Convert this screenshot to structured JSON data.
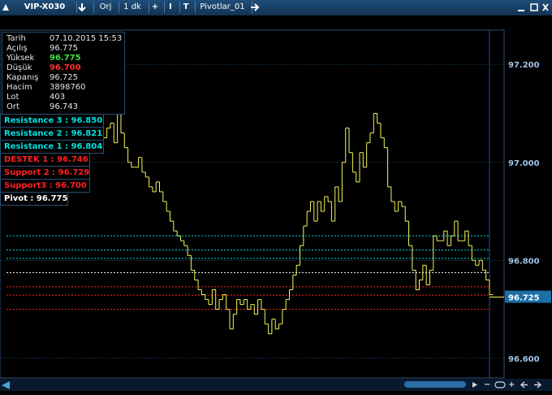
{
  "toolbar": {
    "symbol": "VIP-X030",
    "origin_label": "Orj",
    "period_label": "1 dk",
    "add_label": "+",
    "cursor_label": "I",
    "text_tool_label": "T",
    "template_label": "Pivotlar_01"
  },
  "ohlc": {
    "rows": [
      {
        "label": "Tarih",
        "value": "07.10.2015 15:53"
      },
      {
        "label": "Açılış",
        "value": "96.775"
      },
      {
        "label": "Yüksek",
        "value": "96.775",
        "color": "#3fe03f"
      },
      {
        "label": "Düşük",
        "value": "96.700",
        "color": "#ff3030"
      },
      {
        "label": "Kapanış",
        "value": "96.725"
      },
      {
        "label": "Hacim",
        "value": "3898760"
      },
      {
        "label": "Lot",
        "value": "403"
      },
      {
        "label": "Ort",
        "value": "96.743"
      }
    ]
  },
  "pivots": {
    "r3": "Resistance 3 : 96.850",
    "r2": "Resistance 2 : 96.821",
    "r1": "Resistance 1 : 96.804",
    "destek1": "DESTEK 1 : 96.746",
    "s2": "Support 2 : 96.729",
    "s3": "Support3 : 96.700",
    "pivot": "Pivot : 96.775"
  },
  "colors": {
    "resistance": "#00e0e0",
    "support": "#ff2020",
    "pivot": "#ffffff",
    "price_line": "#f5f55a",
    "current_price_bg": "#1b6fa5"
  },
  "chart_data": {
    "type": "ohlc",
    "ylim": [
      96.56,
      97.27
    ],
    "y_ticks": [
      "97.200",
      "97.000",
      "96.800",
      "96.600"
    ],
    "current_price": "96.725",
    "levels": [
      {
        "name": "Resistance 3",
        "value": 96.85,
        "kind": "resistance"
      },
      {
        "name": "Resistance 2",
        "value": 96.821,
        "kind": "resistance"
      },
      {
        "name": "Resistance 1",
        "value": 96.804,
        "kind": "resistance"
      },
      {
        "name": "Pivot",
        "value": 96.775,
        "kind": "pivot"
      },
      {
        "name": "DESTEK 1",
        "value": 96.746,
        "kind": "support"
      },
      {
        "name": "Support 2",
        "value": 96.729,
        "kind": "support"
      },
      {
        "name": "Support3",
        "value": 96.7,
        "kind": "support"
      }
    ],
    "closes": [
      97.02,
      97.05,
      97.07,
      97.08,
      97.04,
      97.1,
      97.06,
      97.03,
      97.0,
      96.99,
      96.99,
      97.01,
      96.98,
      96.97,
      96.95,
      96.94,
      96.96,
      96.94,
      96.92,
      96.9,
      96.88,
      96.86,
      96.85,
      96.84,
      96.83,
      96.81,
      96.78,
      96.76,
      96.74,
      96.73,
      96.72,
      96.71,
      96.74,
      96.7,
      96.72,
      96.73,
      96.7,
      96.66,
      96.69,
      96.72,
      96.71,
      96.72,
      96.7,
      96.71,
      96.69,
      96.72,
      96.7,
      96.67,
      96.65,
      96.68,
      96.66,
      96.67,
      96.7,
      96.72,
      96.74,
      96.77,
      96.79,
      96.83,
      96.87,
      96.9,
      96.92,
      96.88,
      96.92,
      96.9,
      96.93,
      96.92,
      96.88,
      96.95,
      96.92,
      97.0,
      97.07,
      97.02,
      96.98,
      96.96,
      97.02,
      96.99,
      97.04,
      97.06,
      97.1,
      97.08,
      97.05,
      97.03,
      96.95,
      96.92,
      96.9,
      96.92,
      96.91,
      96.88,
      96.83,
      96.78,
      96.74,
      96.76,
      96.79,
      96.75,
      96.78,
      96.85,
      96.84,
      96.84,
      96.86,
      96.83,
      96.85,
      96.88,
      96.84,
      96.84,
      96.86,
      96.83,
      96.8,
      96.79,
      96.8,
      96.78,
      96.76,
      96.73
    ]
  }
}
